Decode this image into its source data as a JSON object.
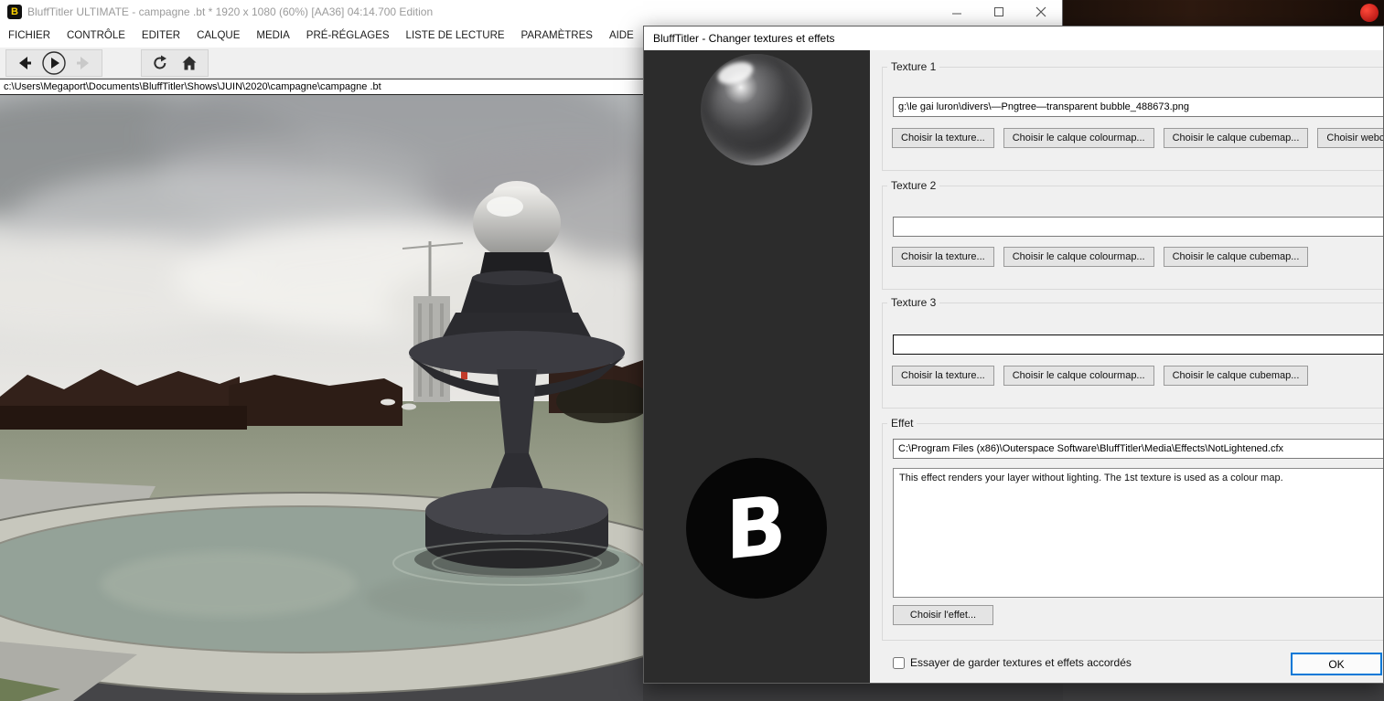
{
  "main_window": {
    "title": "BluffTitler ULTIMATE  - campagne .bt * 1920 x 1080 (60%) [AA36] 04:14.700 Edition",
    "menu": [
      "FICHIER",
      "CONTRÔLE",
      "EDITER",
      "CALQUE",
      "MEDIA",
      "PRÉ-RÉGLAGES",
      "LISTE DE LECTURE",
      "PARAMÈTRES",
      "AIDE"
    ],
    "address": "c:\\Users\\Megaport\\Documents\\BluffTitler\\Shows\\JUIN\\2020\\campagne\\campagne .bt"
  },
  "dialog": {
    "title": "BluffTitler - Changer textures et effets",
    "logo_letter": "B",
    "texture_groups": [
      {
        "label": "Texture 1",
        "path": "g:\\le gai luron\\divers\\—Pngtree—transparent bubble_488673.png",
        "buttons": [
          "Choisir la texture...",
          "Choisir le calque colourmap...",
          "Choisir le calque cubemap...",
          "Choisir webcam..."
        ]
      },
      {
        "label": "Texture 2",
        "path": "",
        "buttons": [
          "Choisir la texture...",
          "Choisir le calque colourmap...",
          "Choisir le calque cubemap..."
        ]
      },
      {
        "label": "Texture 3",
        "path": "",
        "buttons": [
          "Choisir la texture...",
          "Choisir le calque colourmap...",
          "Choisir le calque cubemap..."
        ]
      }
    ],
    "effect": {
      "label": "Effet",
      "path": "C:\\Program Files (x86)\\Outerspace Software\\BluffTitler\\Media\\Effects\\NotLightened.cfx",
      "description": "This effect renders your layer without lighting. The 1st texture is used as a colour map.",
      "button": "Choisir l'effet..."
    },
    "footer": {
      "checkbox_label": "Essayer de garder textures et effets accordés",
      "ok_label": "OK"
    }
  },
  "colors": {
    "accent_blue": "#0078d7",
    "panel_dark": "#2c2c2c",
    "dialog_bg": "#f0f0f0"
  }
}
